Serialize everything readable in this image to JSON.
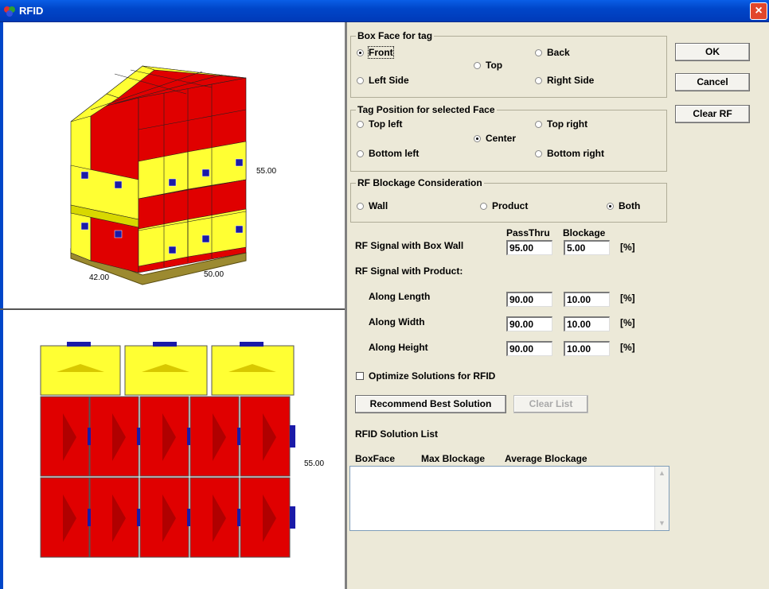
{
  "window": {
    "title": "RFID",
    "close_label": "×"
  },
  "view3d": {
    "height_label": "55.00",
    "length_label": "42.00",
    "width_label": "50.00"
  },
  "view2d": {
    "height_label": "55.00"
  },
  "box_face_group": {
    "legend": "Box Face for tag",
    "options": {
      "front": "Front",
      "top": "Top",
      "back": "Back",
      "left_side": "Left Side",
      "right_side": "Right Side"
    },
    "selected": "Front"
  },
  "tag_position_group": {
    "legend": "Tag Position for selected Face",
    "options": {
      "top_left": "Top left",
      "top_right": "Top right",
      "center": "Center",
      "bottom_left": "Bottom left",
      "bottom_right": "Bottom right"
    },
    "selected": "Center"
  },
  "blockage_group": {
    "legend": "RF Blockage Consideration",
    "options": {
      "wall": "Wall",
      "product": "Product",
      "both": "Both"
    },
    "selected": "Both"
  },
  "signal": {
    "header_passthru": "PassThru",
    "header_blockage": "Blockage",
    "box_wall_label": "RF Signal with Box Wall",
    "box_wall_passthru": "95.00",
    "box_wall_blockage": "5.00",
    "unit": "[%]",
    "product_label": "RF Signal with Product:",
    "along_length_label": "Along Length",
    "along_length_passthru": "90.00",
    "along_length_blockage": "10.00",
    "along_width_label": "Along Width",
    "along_width_passthru": "90.00",
    "along_width_blockage": "10.00",
    "along_height_label": "Along Height",
    "along_height_passthru": "90.00",
    "along_height_blockage": "10.00"
  },
  "optimize_label": "Optimize Solutions for RFID",
  "buttons": {
    "ok": "OK",
    "cancel": "Cancel",
    "clear_rf": "Clear RF",
    "recommend": "Recommend Best Solution",
    "clear_list": "Clear List"
  },
  "solution_list": {
    "title": "RFID Solution List",
    "columns": [
      "BoxFace",
      "Max Blockage",
      "Average Blockage"
    ]
  },
  "colors": {
    "box": "#e00000",
    "box_dark": "#b80000",
    "box_top": "#ffff33",
    "tag": "#1a1aa8",
    "pallet": "#9c8a30"
  }
}
